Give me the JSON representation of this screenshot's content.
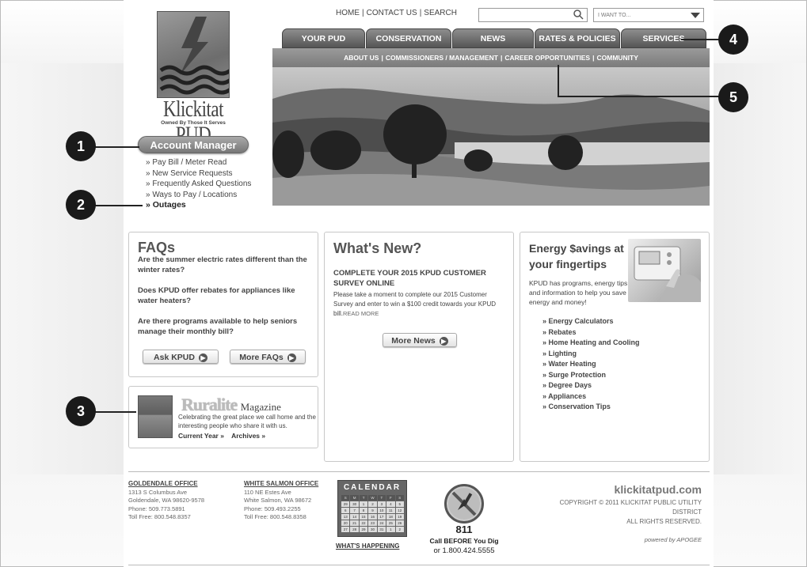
{
  "utility": {
    "home": "HOME",
    "contact": "CONTACT US",
    "search": "SEARCH",
    "sep": "|",
    "iwant_placeholder": "I WANT TO..."
  },
  "logo": {
    "brand": "Klickitat PUD",
    "tagline": "Owned By Those It Serves"
  },
  "tabs": [
    {
      "label": "YOUR PUD"
    },
    {
      "label": "CONSERVATION"
    },
    {
      "label": "NEWS"
    },
    {
      "label": "RATES & POLICIES"
    },
    {
      "label": "SERVICES"
    }
  ],
  "subnav": [
    {
      "label": "ABOUT US"
    },
    {
      "label": "COMMISSIONERS / MANAGEMENT"
    },
    {
      "label": "CAREER OPPORTUNITIES"
    },
    {
      "label": "COMMUNITY"
    }
  ],
  "account": {
    "title": "Account Manager",
    "links": [
      {
        "label": "» Pay Bill / Meter Read"
      },
      {
        "label": "» New Service Requests"
      },
      {
        "label": "» Frequently Asked Questions"
      },
      {
        "label": "» Ways to Pay / Locations"
      },
      {
        "label": "» Outages"
      }
    ]
  },
  "faq": {
    "title": "FAQs",
    "questions": [
      {
        "text": "Are the summer electric rates different than the winter rates?"
      },
      {
        "text": "Does KPUD offer rebates for appliances like water heaters?"
      },
      {
        "text": "Are there programs available to help seniors manage their monthly bill?"
      }
    ],
    "ask_button": "Ask KPUD",
    "more_button": "More FAQs"
  },
  "ruralite": {
    "title": "Ruralite",
    "magazine": "Magazine",
    "text": "Celebrating the great place we call home and the interesting people who share it with us.",
    "current_year": "Current Year »",
    "archives": "Archives »"
  },
  "news": {
    "title": "What's New?",
    "headline": "COMPLETE YOUR 2015 KPUD CUSTOMER SURVEY ONLINE",
    "body": "Please take a moment to complete our 2015 Customer Survey and enter to win a $100 credit towards your KPUD bill.",
    "read_more": "READ MORE",
    "more_button": "More News"
  },
  "energy": {
    "title": "Energy $avings at your fingertips",
    "desc": "KPUD has programs, energy tips, and information to help you save energy and money!",
    "items": [
      {
        "label": "» Energy Calculators"
      },
      {
        "label": "» Rebates"
      },
      {
        "label": "» Home Heating and Cooling"
      },
      {
        "label": "» Lighting"
      },
      {
        "label": "» Water Heating"
      },
      {
        "label": "» Surge Protection"
      },
      {
        "label": "» Degree Days"
      },
      {
        "label": "» Appliances"
      },
      {
        "label": "» Conservation Tips"
      }
    ]
  },
  "footer": {
    "goldendale": {
      "name": "GOLDENDALE OFFICE",
      "addr1": "1313 S Columbus Ave",
      "addr2": "Goldendale, WA 98620-9578",
      "phone": "Phone:  509.773.5891",
      "tollfree": "Toll Free:  800.548.8357"
    },
    "whitesalmon": {
      "name": "WHITE SALMON OFFICE",
      "addr1": "110 NE Estes Ave",
      "addr2": "White Salmon, WA 98672",
      "phone": "Phone:  509.493.2255",
      "tollfree": "Toll Free: 800.548.8358"
    },
    "calendar_title": "CALENDAR",
    "calendar_days": [
      "S",
      "M",
      "T",
      "W",
      "T",
      "F",
      "S"
    ],
    "calendar_dates": [
      "29",
      "30",
      "1",
      "2",
      "3",
      "4",
      "5",
      "6",
      "7",
      "8",
      "9",
      "10",
      "11",
      "12",
      "13",
      "14",
      "15",
      "16",
      "17",
      "18",
      "19",
      "20",
      "21",
      "22",
      "23",
      "24",
      "25",
      "26",
      "27",
      "28",
      "29",
      "30",
      "31",
      "1",
      "2"
    ],
    "calendar_link": "WHAT'S HAPPENING",
    "dig_number": "811",
    "dig_call": "Call BEFORE You Dig",
    "dig_phone": "or 1.800.424.5555",
    "site": "klickitatpud.com",
    "copyright1": "COPYRIGHT © 2011 KLICKITAT PUBLIC UTILITY",
    "copyright2": "DISTRICT",
    "copyright3": "ALL RIGHTS RESERVED.",
    "powered": "powered by APOGEE"
  },
  "callouts": [
    "1",
    "2",
    "3",
    "4",
    "5"
  ]
}
